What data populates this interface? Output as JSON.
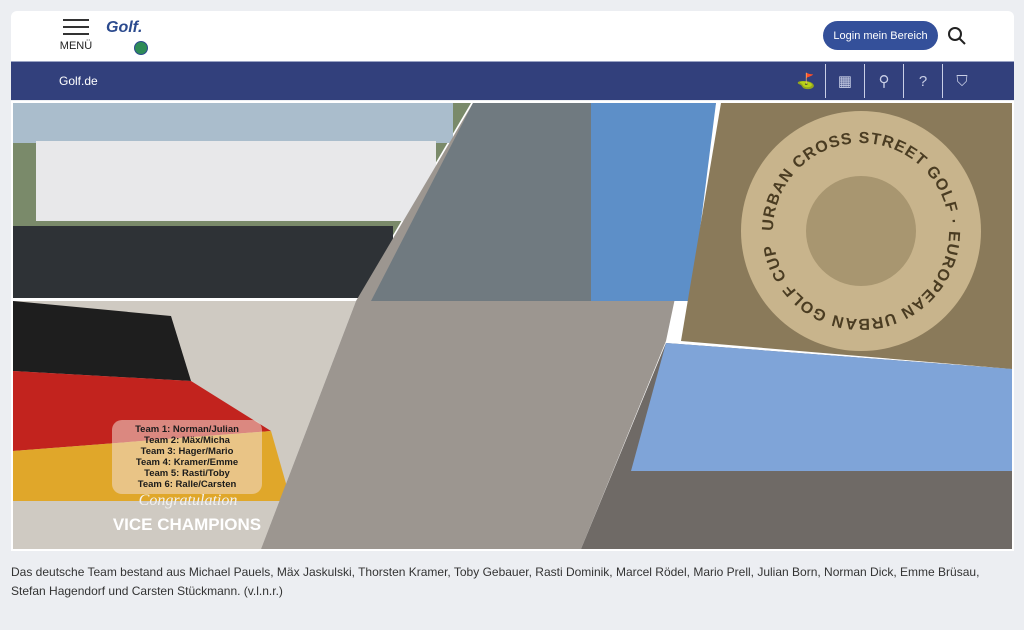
{
  "header": {
    "menu_label": "MENÜ",
    "logo_text": "Golf.de",
    "login_label": "Login mein Bereich"
  },
  "nav": {
    "breadcrumb": "Golf.de",
    "icons": [
      "golf-club-icon",
      "calendar-icon",
      "podium-icon",
      "help-icon",
      "shield-check-icon"
    ],
    "color": "#32407c"
  },
  "image": {
    "teams": [
      "Team 1: Norman/Julian",
      "Team 2: Mäx/Micha",
      "Team 3: Hager/Mario",
      "Team 4: Kramer/Emme",
      "Team 5: Rasti/Toby",
      "Team 6: Ralle/Carsten"
    ],
    "congrats": "Congratulation",
    "title": "VICE CHAMPIONS",
    "medal_text": "URBAN CROSS STREET GOLF · EUROPEAN URBAN GOLF CUP"
  },
  "caption": "Das deutsche Team bestand aus Michael Pauels, Mäx Jaskulski, Thorsten Kramer, Toby Gebauer, Rasti Dominik, Marcel Rödel, Mario Prell, Julian Born, Norman Dick, Emme Brüsau, Stefan Hagendorf und Carsten Stückmann. (v.l.n.r.)"
}
